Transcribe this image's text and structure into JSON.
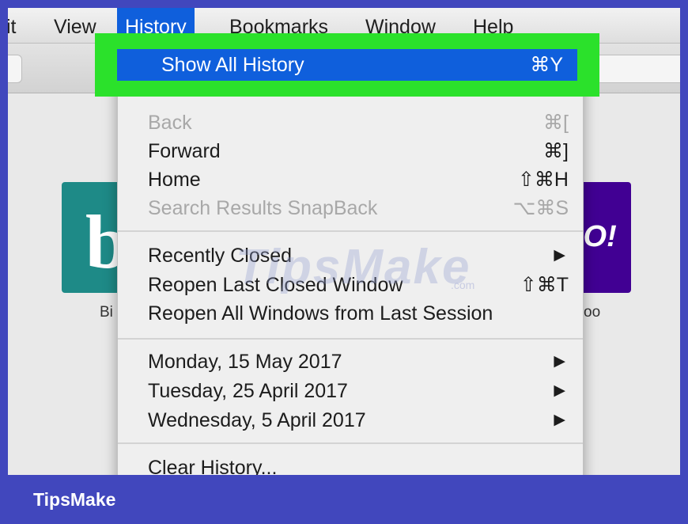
{
  "menubar": {
    "items": [
      {
        "label": "it"
      },
      {
        "label": "View"
      },
      {
        "label": "History"
      },
      {
        "label": "Bookmarks"
      },
      {
        "label": "Window"
      },
      {
        "label": "Help"
      }
    ]
  },
  "tiles": [
    {
      "label": "Bi",
      "glyph": "b",
      "color": "#1e8a87"
    },
    {
      "label": "oo",
      "glyph": "OO!",
      "color": "#410093"
    }
  ],
  "history_menu": {
    "highlighted": {
      "label": "Show All History",
      "shortcut": "⌘Y"
    },
    "items": [
      {
        "label": "Back",
        "shortcut": "⌘[",
        "disabled": true
      },
      {
        "label": "Forward",
        "shortcut": "⌘]",
        "disabled": false
      },
      {
        "label": "Home",
        "shortcut": "⇧⌘H",
        "disabled": false
      },
      {
        "label": "Search Results SnapBack",
        "shortcut": "⌥⌘S",
        "disabled": true
      },
      {
        "label": "Recently Closed",
        "submenu": true
      },
      {
        "label": "Reopen Last Closed Window",
        "shortcut": "⇧⌘T"
      },
      {
        "label": "Reopen All Windows from Last Session"
      },
      {
        "label": "Monday, 15 May 2017",
        "submenu": true
      },
      {
        "label": "Tuesday, 25 April 2017",
        "submenu": true
      },
      {
        "label": "Wednesday, 5 April 2017",
        "submenu": true
      },
      {
        "label": "Clear History..."
      }
    ],
    "submenu_icon": "triangle-right-icon"
  },
  "watermark": {
    "text": "TipsMake",
    "small": ".com"
  },
  "footer": {
    "brand": "TipsMake"
  },
  "colors": {
    "selection": "#0f5fdc",
    "annotation": "#2be12b",
    "frame": "#4147bd"
  }
}
